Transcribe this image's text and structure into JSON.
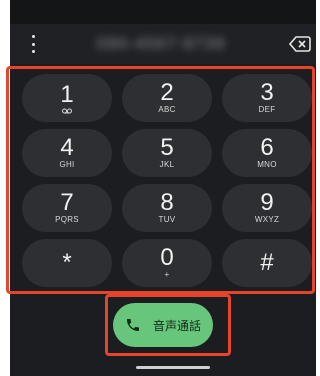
{
  "number_display": {
    "value": "090-4567-9739",
    "menu_icon": "more-vert-icon",
    "backspace_icon": "backspace-icon"
  },
  "keypad": [
    {
      "digit": "1",
      "letters": "",
      "icon": "voicemail-icon"
    },
    {
      "digit": "2",
      "letters": "ABC"
    },
    {
      "digit": "3",
      "letters": "DEF"
    },
    {
      "digit": "4",
      "letters": "GHI"
    },
    {
      "digit": "5",
      "letters": "JKL"
    },
    {
      "digit": "6",
      "letters": "MNO"
    },
    {
      "digit": "7",
      "letters": "PQRS"
    },
    {
      "digit": "8",
      "letters": "TUV"
    },
    {
      "digit": "9",
      "letters": "WXYZ"
    },
    {
      "digit": "*",
      "letters": ""
    },
    {
      "digit": "0",
      "letters": "+"
    },
    {
      "digit": "#",
      "letters": ""
    }
  ],
  "call_button": {
    "label": "音声通話",
    "icon": "phone-icon",
    "color": "#68c67c"
  },
  "highlight_color": "#e6452c"
}
